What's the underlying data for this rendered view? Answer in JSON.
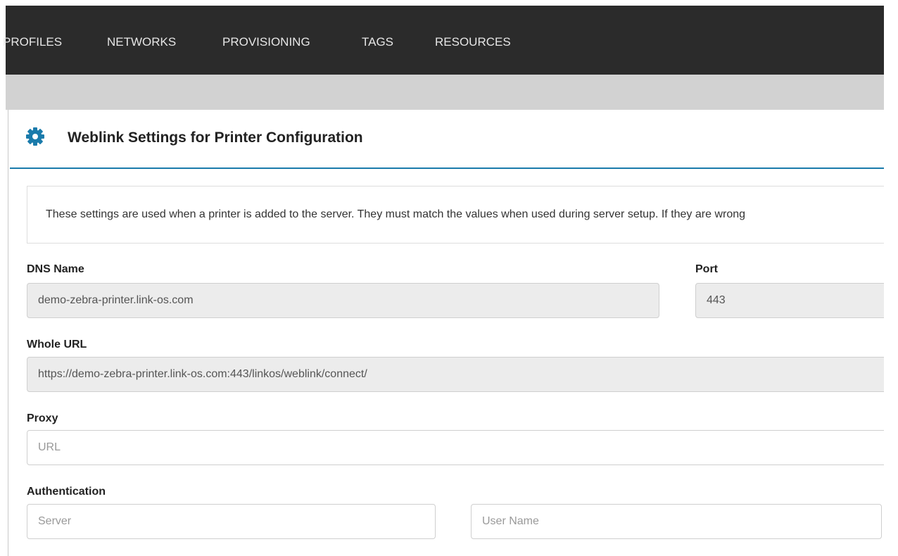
{
  "nav": {
    "items": [
      {
        "label": "PROFILES"
      },
      {
        "label": "NETWORKS"
      },
      {
        "label": "PROVISIONING"
      },
      {
        "label": "TAGS"
      },
      {
        "label": "RESOURCES"
      }
    ]
  },
  "panel": {
    "title": "Weblink Settings for Printer Configuration",
    "icon": "gear-icon",
    "accent_color": "#1a7bab"
  },
  "info": {
    "text": "These settings are used when a printer is added to the server. They must match the values when used during server setup. If they are wrong"
  },
  "form": {
    "dns_label": "DNS Name",
    "dns_value": "demo-zebra-printer.link-os.com",
    "port_label": "Port",
    "port_value": "443",
    "url_label": "Whole URL",
    "url_value": "https://demo-zebra-printer.link-os.com:443/linkos/weblink/connect/",
    "proxy_label": "Proxy",
    "proxy_placeholder": "URL",
    "auth_label": "Authentication",
    "server_placeholder": "Server",
    "username_placeholder": "User Name"
  }
}
